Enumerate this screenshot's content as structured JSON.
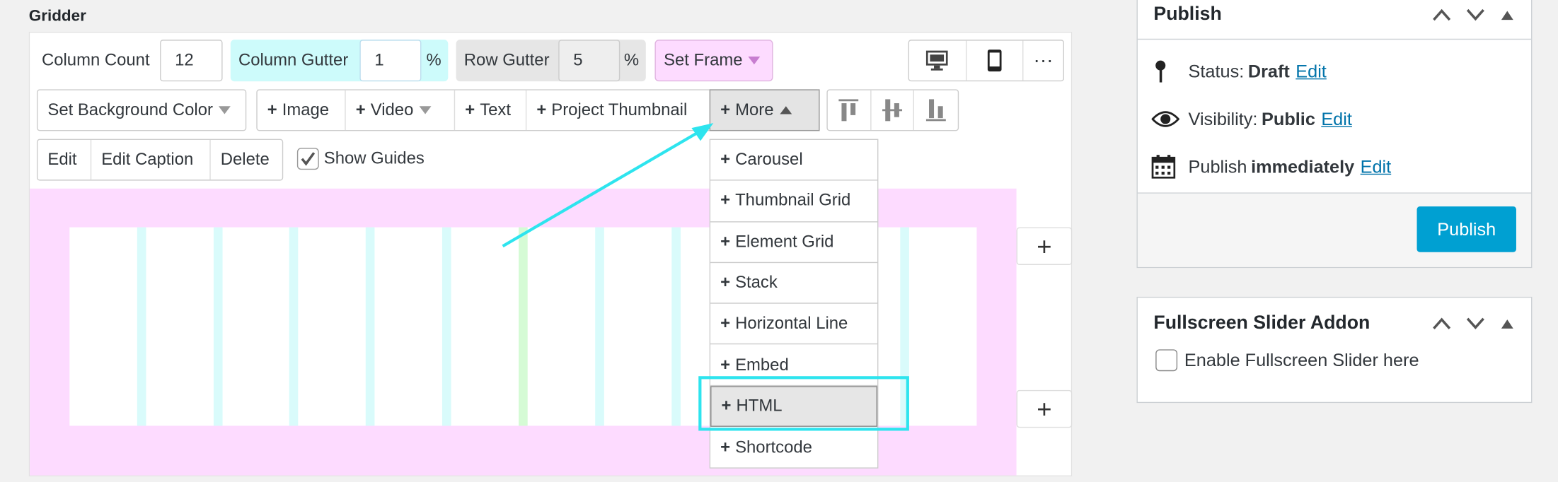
{
  "gridder": {
    "title": "Gridder",
    "column_count_label": "Column Count",
    "column_count_value": "12",
    "column_gutter_label": "Column Gutter",
    "column_gutter_value": "1",
    "row_gutter_label": "Row Gutter",
    "row_gutter_value": "5",
    "percent": "%",
    "set_frame": "Set Frame",
    "set_bg": "Set Background Color",
    "add_buttons": [
      "Image",
      "Video",
      "Text",
      "Project Thumbnail",
      "More"
    ],
    "edit_buttons": [
      "Edit",
      "Edit Caption",
      "Delete"
    ],
    "show_guides": "Show Guides",
    "plus_sign": "+",
    "more_menu": [
      "Carousel",
      "Thumbnail Grid",
      "Element Grid",
      "Stack",
      "Horizontal Line",
      "Embed",
      "HTML",
      "Shortcode"
    ],
    "highlighted_item": "HTML"
  },
  "publish": {
    "title": "Publish",
    "status_label": "Status: ",
    "status_value": "Draft",
    "visibility_label": "Visibility: ",
    "visibility_value": "Public",
    "publish_label": "Publish ",
    "publish_value": "immediately",
    "edit": "Edit",
    "button": "Publish"
  },
  "slider": {
    "title": "Fullscreen Slider Addon",
    "checkbox_label": "Enable Fullscreen Slider here"
  },
  "colors": {
    "accent": "#00a0d2",
    "canvas": "#fddbff",
    "gutter_col": "#d9fbfb",
    "gutter_label": "#cdfbfb",
    "highlight": "#2ee4ee"
  }
}
